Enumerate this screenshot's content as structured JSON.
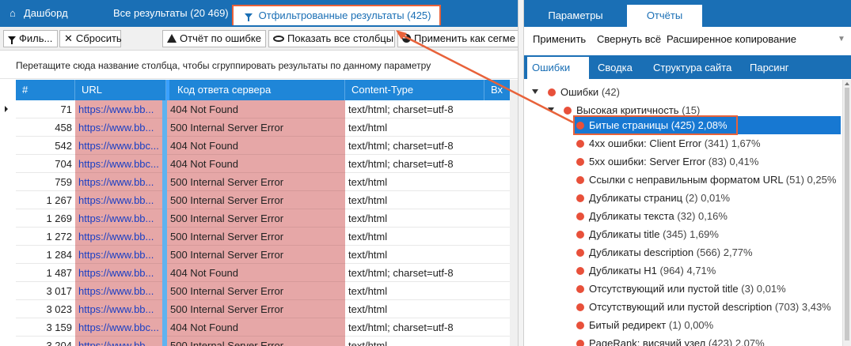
{
  "left_tabs": {
    "dashboard": "Дашборд",
    "all": "Все результаты (20 469)",
    "filtered": "Отфильтрованные результаты (425)"
  },
  "toolbar": {
    "filter": "Филь...",
    "reset": "Сбросить",
    "report": "Отчёт по ошибке",
    "show_columns": "Показать все столбцы",
    "apply_segment": "Применить как сегме"
  },
  "group_hint": "Перетащите сюда название столбца, чтобы сгруппировать результаты по данному параметру",
  "grid": {
    "columns": [
      "#",
      "URL",
      "Код ответа сервера",
      "Content-Type",
      "Вх"
    ],
    "rows": [
      {
        "num": "71",
        "url": "https://www.bb...",
        "code": "404 Not Found",
        "ct": "text/html; charset=utf-8"
      },
      {
        "num": "458",
        "url": "https://www.bb...",
        "code": "500 Internal Server Error",
        "ct": "text/html"
      },
      {
        "num": "542",
        "url": "https://www.bbc...",
        "code": "404 Not Found",
        "ct": "text/html; charset=utf-8"
      },
      {
        "num": "704",
        "url": "https://www.bbc...",
        "code": "404 Not Found",
        "ct": "text/html; charset=utf-8"
      },
      {
        "num": "759",
        "url": "https://www.bb...",
        "code": "500 Internal Server Error",
        "ct": "text/html"
      },
      {
        "num": "1 267",
        "url": "https://www.bb...",
        "code": "500 Internal Server Error",
        "ct": "text/html"
      },
      {
        "num": "1 269",
        "url": "https://www.bb...",
        "code": "500 Internal Server Error",
        "ct": "text/html"
      },
      {
        "num": "1 272",
        "url": "https://www.bb...",
        "code": "500 Internal Server Error",
        "ct": "text/html"
      },
      {
        "num": "1 284",
        "url": "https://www.bb...",
        "code": "500 Internal Server Error",
        "ct": "text/html"
      },
      {
        "num": "1 487",
        "url": "https://www.bb...",
        "code": "404 Not Found",
        "ct": "text/html; charset=utf-8"
      },
      {
        "num": "3 017",
        "url": "https://www.bb...",
        "code": "500 Internal Server Error",
        "ct": "text/html"
      },
      {
        "num": "3 023",
        "url": "https://www.bb...",
        "code": "500 Internal Server Error",
        "ct": "text/html"
      },
      {
        "num": "3 159",
        "url": "https://www.bbc...",
        "code": "404 Not Found",
        "ct": "text/html; charset=utf-8"
      },
      {
        "num": "3 204",
        "url": "https://www.bb...",
        "code": "500 Internal Server Error",
        "ct": "text/html"
      }
    ]
  },
  "right_tabs": {
    "params": "Параметры",
    "reports": "Отчёты"
  },
  "right_actions": {
    "apply": "Применить",
    "collapse": "Свернуть всё",
    "copy": "Расширенное копирование"
  },
  "report_tabs": {
    "errors": "Ошибки",
    "summary": "Сводка",
    "structure": "Структура сайта",
    "parsing": "Парсинг"
  },
  "tree": {
    "root": {
      "label": "Ошибки",
      "count": "(42)"
    },
    "high": {
      "label": "Высокая критичность",
      "count": "(15)"
    },
    "items": [
      {
        "label": "Битые страницы",
        "count": "(425) 2,08%"
      },
      {
        "label": "4xx ошибки: Client Error",
        "count": "(341) 1,67%"
      },
      {
        "label": "5xx ошибки: Server Error",
        "count": "(83) 0,41%"
      },
      {
        "label": "Ссылки с неправильным форматом URL",
        "count": "(51) 0,25%"
      },
      {
        "label": "Дубликаты страниц",
        "count": "(2) 0,01%"
      },
      {
        "label": "Дубликаты текста",
        "count": "(32) 0,16%"
      },
      {
        "label": "Дубликаты title",
        "count": "(345) 1,69%"
      },
      {
        "label": "Дубликаты description",
        "count": "(566) 2,77%"
      },
      {
        "label": "Дубликаты H1",
        "count": "(964) 4,71%"
      },
      {
        "label": "Отсутствующий или пустой title",
        "count": "(3) 0,01%"
      },
      {
        "label": "Отсутствующий или пустой description",
        "count": "(703) 3,43%"
      },
      {
        "label": "Битый редирект",
        "count": "(1) 0,00%"
      },
      {
        "label": "PageRank: висячий узел",
        "count": "(423) 2,07%"
      }
    ]
  },
  "colors": {
    "brand_blue": "#1a6fb5",
    "header_blue": "#1f86d8",
    "selection_blue": "#1778d2",
    "highlight_pink": "#e6a7a7",
    "callout_orange": "#e8623a",
    "error_dot": "#e8503a",
    "link_blue": "#1a3fc4"
  }
}
